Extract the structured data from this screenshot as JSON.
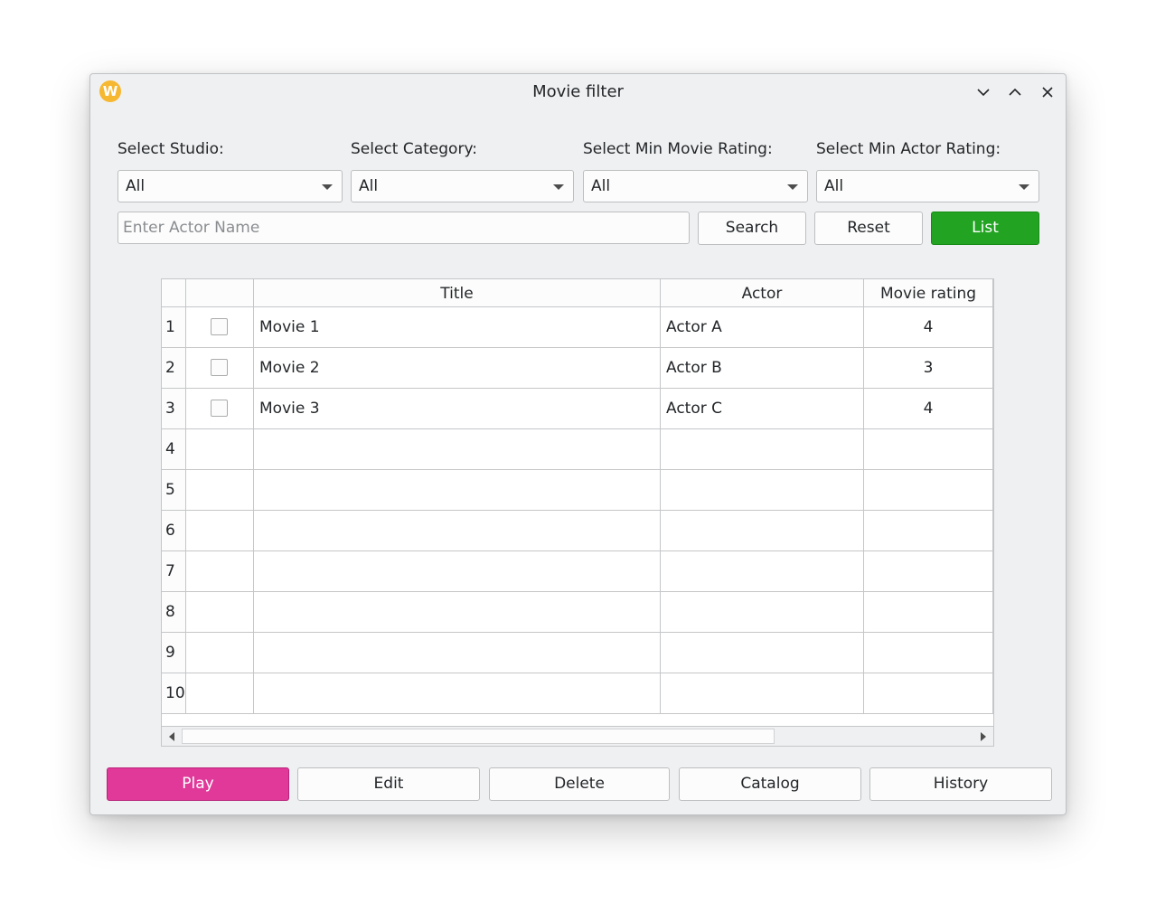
{
  "window": {
    "title": "Movie filter"
  },
  "filters": {
    "studio": {
      "label": "Select Studio:",
      "value": "All"
    },
    "category": {
      "label": "Select Category:",
      "value": "All"
    },
    "movie_rating": {
      "label": "Select Min Movie Rating:",
      "value": "All"
    },
    "actor_rating": {
      "label": "Select Min Actor Rating:",
      "value": "All"
    }
  },
  "search": {
    "placeholder": "Enter Actor Name",
    "value": ""
  },
  "buttons": {
    "search": "Search",
    "reset": "Reset",
    "list": "List",
    "play": "Play",
    "edit": "Edit",
    "delete": "Delete",
    "catalog": "Catalog",
    "history": "History"
  },
  "table": {
    "columns": [
      "",
      "Title",
      "Actor",
      "Movie rating"
    ],
    "rows": [
      {
        "num": "1",
        "title": "Movie 1",
        "actor": "Actor A",
        "rating": "4"
      },
      {
        "num": "2",
        "title": "Movie 2",
        "actor": "Actor B",
        "rating": "3"
      },
      {
        "num": "3",
        "title": "Movie 3",
        "actor": "Actor C",
        "rating": "4"
      },
      {
        "num": "4",
        "title": "",
        "actor": "",
        "rating": ""
      },
      {
        "num": "5",
        "title": "",
        "actor": "",
        "rating": ""
      },
      {
        "num": "6",
        "title": "",
        "actor": "",
        "rating": ""
      },
      {
        "num": "7",
        "title": "",
        "actor": "",
        "rating": ""
      },
      {
        "num": "8",
        "title": "",
        "actor": "",
        "rating": ""
      },
      {
        "num": "9",
        "title": "",
        "actor": "",
        "rating": ""
      },
      {
        "num": "10",
        "title": "",
        "actor": "",
        "rating": ""
      }
    ]
  },
  "colors": {
    "list_button": "#22a322",
    "play_button": "#e0399a",
    "app_logo": "#f6b731"
  },
  "icons": {
    "app": "app-logo-icon",
    "minimize": "chevron-down-icon",
    "maximize": "chevron-up-icon",
    "close": "close-icon"
  }
}
